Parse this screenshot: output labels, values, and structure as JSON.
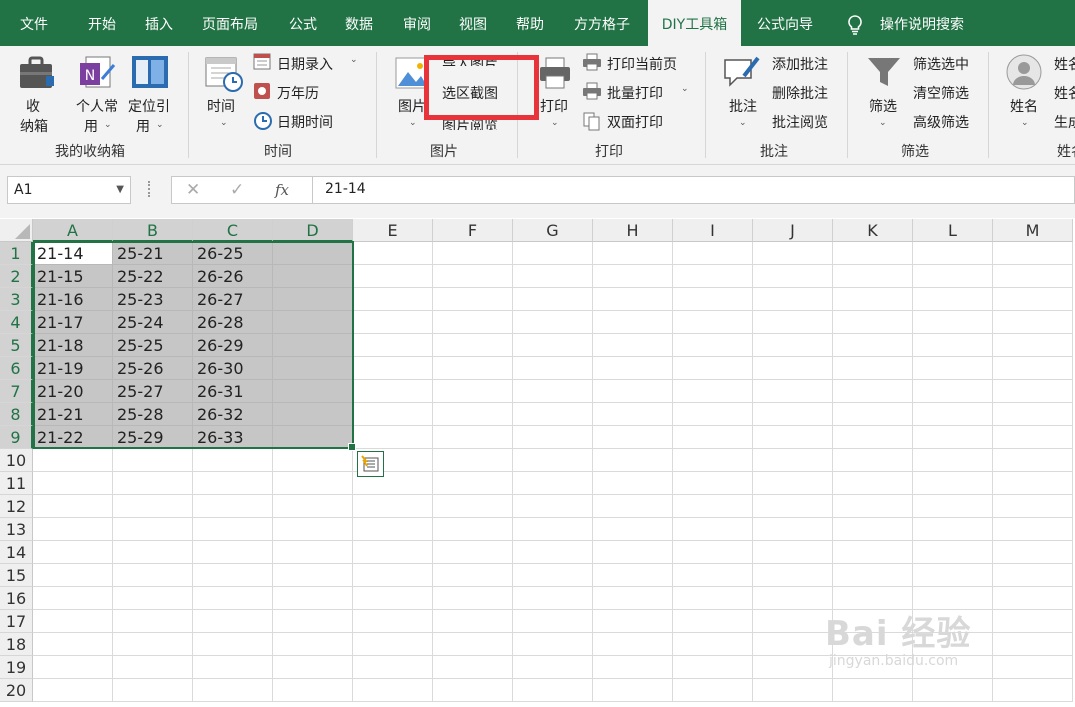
{
  "tabs": [
    "文件",
    "开始",
    "插入",
    "页面布局",
    "公式",
    "数据",
    "审阅",
    "视图",
    "帮助",
    "方方格子",
    "DIY工具箱",
    "公式向导",
    "操作说明搜索"
  ],
  "active_tab": "DIY工具箱",
  "ribbon": {
    "storage": {
      "box_label_1": "收",
      "box_label_2": "纳箱",
      "personal_1": "个人常",
      "personal_2": "用",
      "locate_1": "定位引",
      "locate_2": "用",
      "group": "我的收纳箱"
    },
    "time": {
      "big": "时间",
      "date_entry": "日期录入",
      "calendar": "万年历",
      "datetime": "日期时间",
      "group": "时间"
    },
    "picture": {
      "big": "图片",
      "import": "导入图片",
      "screenshot": "选区截图",
      "browse": "图片阅览",
      "group": "图片"
    },
    "print": {
      "big": "打印",
      "current": "打印当前页",
      "batch": "批量打印",
      "duplex": "双面打印",
      "group": "打印"
    },
    "comment": {
      "big": "批注",
      "add": "添加批注",
      "delete": "删除批注",
      "browse": "批注阅览",
      "group": "批注"
    },
    "filter": {
      "big": "筛选",
      "filter_selected": "筛选选中",
      "clear": "清空筛选",
      "advanced": "高级筛选",
      "group": "筛选"
    },
    "name": {
      "big": "姓名",
      "item1": "姓名",
      "item2": "姓名",
      "item3": "生成",
      "group": "姓名"
    }
  },
  "formula_bar": {
    "name_box": "A1",
    "formula": "21-14",
    "fx": "fx"
  },
  "columns": [
    "A",
    "B",
    "C",
    "D",
    "E",
    "F",
    "G",
    "H",
    "I",
    "J",
    "K",
    "L",
    "M"
  ],
  "rows": [
    "1",
    "2",
    "3",
    "4",
    "5",
    "6",
    "7",
    "8",
    "9",
    "10",
    "11",
    "12",
    "13",
    "14",
    "15",
    "16",
    "17",
    "18",
    "19",
    "20"
  ],
  "cells": [
    [
      "21-14",
      "25-21",
      "26-25"
    ],
    [
      "21-15",
      "25-22",
      "26-26"
    ],
    [
      "21-16",
      "25-23",
      "26-27"
    ],
    [
      "21-17",
      "25-24",
      "26-28"
    ],
    [
      "21-18",
      "25-25",
      "26-29"
    ],
    [
      "21-19",
      "25-26",
      "26-30"
    ],
    [
      "21-20",
      "25-27",
      "26-31"
    ],
    [
      "21-21",
      "25-28",
      "26-32"
    ],
    [
      "21-22",
      "25-29",
      "26-33"
    ]
  ],
  "watermark": {
    "brand": "Bai 经验",
    "url": "jingyan.baidu.com"
  },
  "colors": {
    "excel_green": "#217346",
    "highlight_red": "#e8333a",
    "selection_gray": "#c6c6c6"
  }
}
